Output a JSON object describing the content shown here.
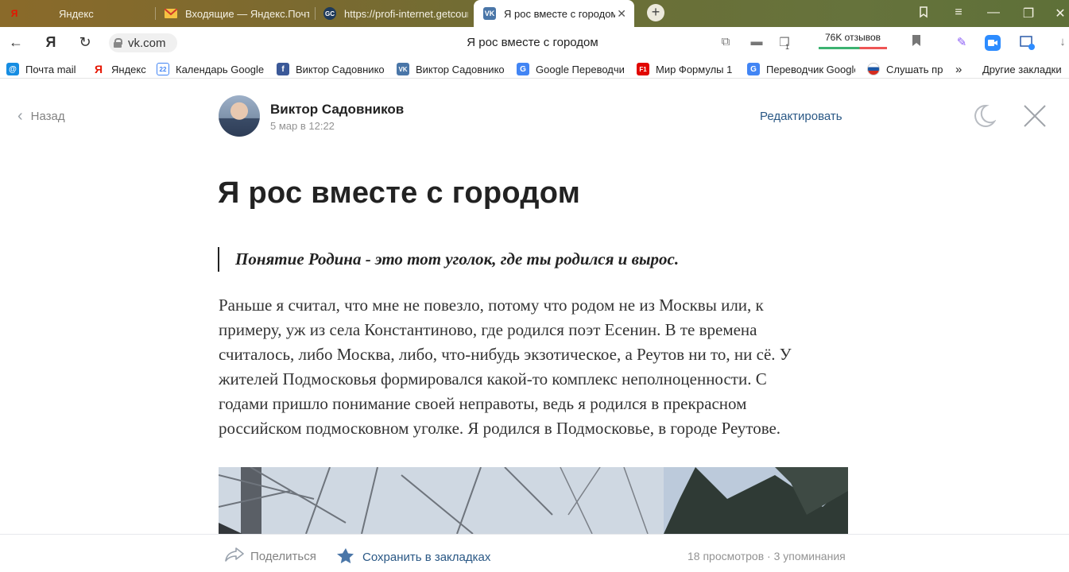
{
  "tabs": [
    {
      "label": "Яндекс",
      "icon": "yandex-icon"
    },
    {
      "label": "Входящие — Яндекс.Почта",
      "icon": "mail-icon"
    },
    {
      "label": "https://profi-internet.getcourse",
      "icon": "getcourse-icon"
    },
    {
      "label": "Я рос вместе с городом",
      "icon": "vk-icon",
      "active": true
    }
  ],
  "address": {
    "domain": "vk.com",
    "page_title": "Я рос вместе с городом",
    "reviews": "76K отзывов",
    "tab_count_badge": "1"
  },
  "bookmarks": [
    {
      "label": "Почта mail",
      "icon": "mail-ru-icon"
    },
    {
      "label": "Яндекс",
      "icon": "yandex-icon"
    },
    {
      "label": "Календарь Google",
      "icon": "google-calendar-icon"
    },
    {
      "label": "Виктор Садовников",
      "icon": "facebook-icon"
    },
    {
      "label": "Виктор Садовников",
      "icon": "vk-icon"
    },
    {
      "label": "Google Переводчик",
      "icon": "google-translate-icon"
    },
    {
      "label": "Мир Формулы 1",
      "icon": "f1-icon"
    },
    {
      "label": "Переводчик Google",
      "icon": "google-translate-icon"
    },
    {
      "label": "Слушать пр",
      "icon": "radio-icon"
    }
  ],
  "bookmarks_more": "»",
  "bookmarks_other": "Другие закладки",
  "article": {
    "back_label": "Назад",
    "author": "Виктор Садовников",
    "date": "5 мар в 12:22",
    "edit_label": "Редактировать",
    "title": "Я рос вместе с городом",
    "quote": "Понятие Родина - это тот уголок, где ты родился и вырос.",
    "paragraph_lines": [
      "Раньше я считал, что мне не повезло, потому что родом не из Москвы или, к",
      "примеру, уж из села Константиново, где родился поэт Есенин. В те времена",
      "считалось, либо Москва, либо, что-нибудь экзотическое, а Реутов ни то, ни сё. У",
      "жителей Подмосковья формировался какой-то комплекс неполноценности. С",
      "годами пришло понимание своей неправоты, ведь я родился в прекрасном",
      "российском подмосковном уголке. Я родился в Подмосковье, в городе Реутове."
    ]
  },
  "footer": {
    "share_label": "Поделиться",
    "save_label": "Сохранить в закладках",
    "stats": "18 просмотров · 3 упоминания"
  },
  "colors": {
    "link": "#2a5885",
    "muted": "#828282",
    "vk_blue": "#4a76a8"
  }
}
